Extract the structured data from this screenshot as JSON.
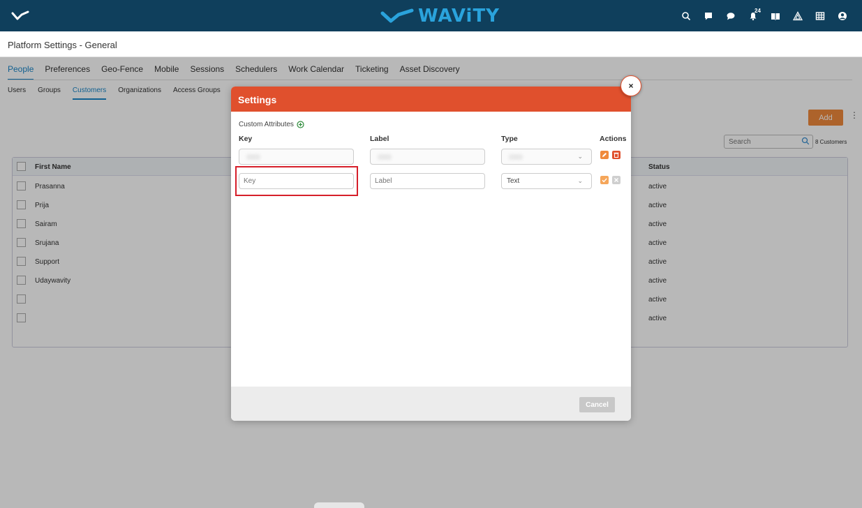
{
  "header": {
    "brand_name": "WAViTY",
    "notification_count": "24",
    "colors": {
      "bar": "#0f3f5c",
      "brand": "#2aa3dc"
    },
    "icons": [
      "search-icon",
      "chat-square-icon",
      "chat-bubble-icon",
      "bell-icon",
      "book-icon",
      "alert-triangle-icon",
      "grid-icon",
      "user-avatar-icon"
    ]
  },
  "page": {
    "title": "Platform Settings - General"
  },
  "main_tabs": [
    "People",
    "Preferences",
    "Geo-Fence",
    "Mobile",
    "Sessions",
    "Schedulers",
    "Work Calendar",
    "Ticketing",
    "Asset Discovery"
  ],
  "sub_tabs": [
    "Users",
    "Groups",
    "Customers",
    "Organizations",
    "Access Groups"
  ],
  "toolbar": {
    "add_label": "Add",
    "search_placeholder": "Search",
    "count_label": "8 Customers"
  },
  "table": {
    "headers": {
      "first_name": "First Name",
      "status": "Status"
    },
    "rows": [
      {
        "first_name": "Prasanna",
        "status": "active"
      },
      {
        "first_name": "Prija",
        "status": "active"
      },
      {
        "first_name": "Sairam",
        "status": "active"
      },
      {
        "first_name": "Srujana",
        "status": "active"
      },
      {
        "first_name": "Support",
        "status": "active"
      },
      {
        "first_name": "Udaywavity",
        "status": "active"
      },
      {
        "first_name": "",
        "status": "active"
      },
      {
        "first_name": "",
        "status": "active"
      }
    ]
  },
  "modal": {
    "title": "Settings",
    "close_label": "×",
    "custom_attributes_label": "Custom Attributes",
    "columns": {
      "key": "Key",
      "label": "Label",
      "type": "Type",
      "actions": "Actions"
    },
    "new_row": {
      "key_placeholder": "Key",
      "label_placeholder": "Label",
      "type_value": "Text"
    },
    "cancel_label": "Cancel",
    "colors": {
      "header": "#e0502d",
      "accent": "#f08a3c",
      "highlight": "#d61f2a"
    }
  }
}
